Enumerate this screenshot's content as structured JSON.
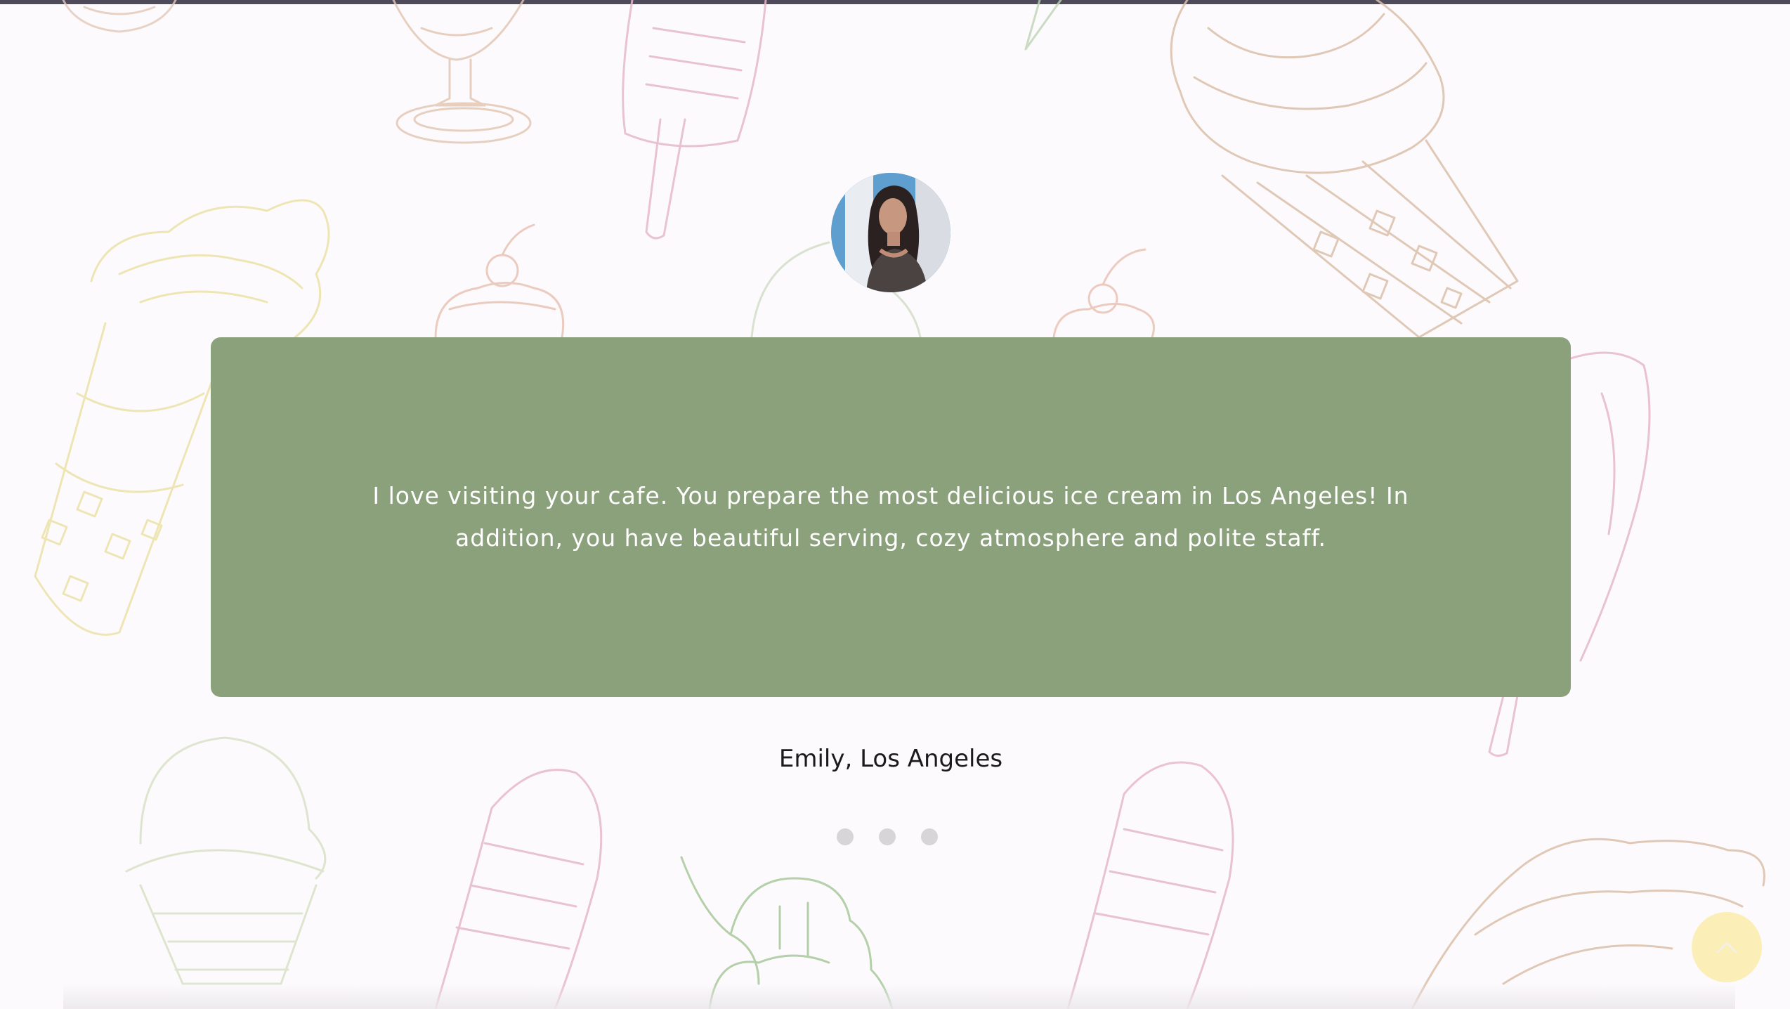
{
  "testimonial": {
    "quote": "I love visiting your cafe. You prepare the most delicious ice cream in Los Angeles! In addition, you have beautiful serving, cozy atmosphere and polite staff.",
    "author": "Emily, Los Angeles"
  },
  "carousel": {
    "dot_count": 3
  },
  "icons": {
    "scroll_top": "chevron-up-icon",
    "background": "ice-cream-sketch-pattern"
  },
  "colors": {
    "card": "#8ba17c",
    "dot": "#d7d5d8",
    "scroll_button": "#faecaa"
  }
}
